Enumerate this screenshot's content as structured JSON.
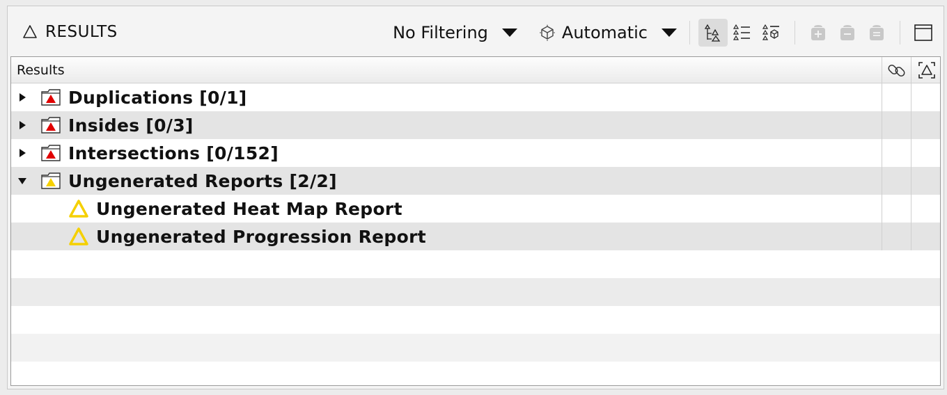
{
  "header": {
    "title": "RESULTS",
    "title_icon": "results-triangle-icon",
    "filter_dropdown": "No Filtering",
    "mode_dropdown": "Automatic",
    "mode_icon": "cube-icon"
  },
  "toolbar_icons": [
    "tree-view-icon",
    "list-view-icon",
    "grouped-view-icon",
    "add-icon",
    "remove-icon",
    "clear-icon",
    "maximize-window-icon"
  ],
  "table": {
    "column_header": "Results",
    "link_column_icon": "link-icon",
    "focus_column_icon": "focus-icon"
  },
  "rows": [
    {
      "label": "Duplications [0/1]",
      "expanded": false,
      "severity": "error"
    },
    {
      "label": "Insides [0/3]",
      "expanded": false,
      "severity": "error"
    },
    {
      "label": "Intersections [0/152]",
      "expanded": false,
      "severity": "error"
    },
    {
      "label": "Ungenerated Reports [2/2]",
      "expanded": true,
      "severity": "warning"
    }
  ],
  "children": [
    {
      "label": "Ungenerated Heat Map Report",
      "severity": "warning"
    },
    {
      "label": "Ungenerated Progression Report",
      "severity": "warning"
    }
  ],
  "colors": {
    "error": "#e00000",
    "warning": "#f5d000",
    "row_alt": "#e4e4e4"
  }
}
